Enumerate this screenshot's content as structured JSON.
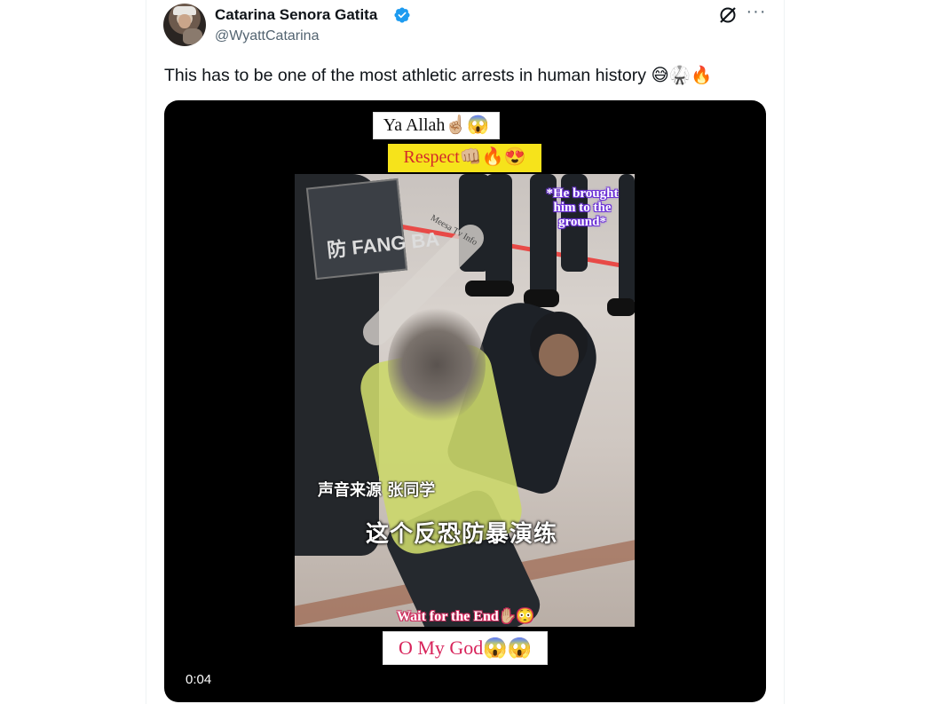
{
  "author": {
    "display_name": "Catarina Senora Gatita",
    "handle": "@WyattCatarina",
    "verified": true,
    "avatar_icon": "profile-photo"
  },
  "header_actions": {
    "grok_icon": "grok-icon",
    "more_label": "···"
  },
  "tweet": {
    "text": "This has to be one of the most athletic arrests in human history 😅🥋🔥"
  },
  "video": {
    "caption_top": "Ya Allah☝🏼😱",
    "caption_respect": "Respect👊🏼🔥😍",
    "caption_bottom": "O My God😱😱",
    "overlay_note": "*He brought him to the ground*",
    "watermark": "Meesa Tv Info",
    "shield_text": "防 FANG BA",
    "subtitle_small": "声音来源 张同学",
    "subtitle_big": "这个反恐防暴演练",
    "wait_text": "Wait for the End✋🏼😳",
    "timestamp": "0:04"
  },
  "colors": {
    "verified_blue": "#1d9bf0",
    "respect_bg": "#f6e31b",
    "respect_text": "#d32a2a",
    "bottom_caption": "#d8245b",
    "note_outline": "#6a2fd6"
  }
}
